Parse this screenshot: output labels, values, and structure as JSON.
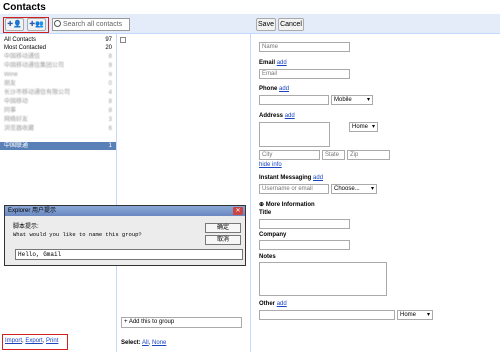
{
  "app": {
    "title": "Contacts"
  },
  "toolbar": {
    "add_contact_icon": "person-plus-icon",
    "add_group_icon": "group-plus-icon",
    "search_placeholder": "Search all contacts",
    "save_label": "Save",
    "cancel_label": "Cancel"
  },
  "groups": [
    {
      "label": "All Contacts",
      "count": "97"
    },
    {
      "label": "Most Contacted",
      "count": "20"
    },
    {
      "label": "中国移动通信",
      "count": "8"
    },
    {
      "label": "中国移动通信集团公司",
      "count": "9"
    },
    {
      "label": "Wine",
      "count": "9"
    },
    {
      "label": "朋友",
      "count": "0"
    },
    {
      "label": "长沙市移动通信有限公司",
      "count": "4"
    },
    {
      "label": "中国移动",
      "count": "8"
    },
    {
      "label": "同事",
      "count": "8"
    },
    {
      "label": "网络好友",
      "count": "3"
    },
    {
      "label": "浏览器收藏",
      "count": "6"
    },
    {
      "label": "中国联通",
      "count": "1"
    }
  ],
  "form": {
    "name_placeholder": "Name",
    "email_label": "Email",
    "add": "add",
    "email_placeholder": "Email",
    "phone_label": "Phone",
    "phone_type": "Mobile",
    "address_label": "Address",
    "address_type": "Home",
    "city_placeholder": "City",
    "state_placeholder": "State",
    "zip_placeholder": "Zip",
    "hide_info": "hide info",
    "im_label": "Instant Messaging",
    "im_placeholder": "Username or email",
    "im_choose": "Choose...",
    "more_info": "More Information",
    "title_label": "Title",
    "company_label": "Company",
    "notes_label": "Notes",
    "other_label": "Other",
    "other_type": "Home"
  },
  "dialog": {
    "title": "Explorer 用户提示",
    "script_prompt_label": "脚本提示:",
    "question": "What would you like to name this group?",
    "ok": "确定",
    "cancel": "取消",
    "value": "Hello, Gmail"
  },
  "contacts_pane": {
    "add_to_group": "+ Add this to group",
    "select_label": "Select:",
    "select_all": "All",
    "select_none": "None"
  },
  "footer": {
    "import": "Import",
    "export": "Export",
    "print": "Print"
  }
}
